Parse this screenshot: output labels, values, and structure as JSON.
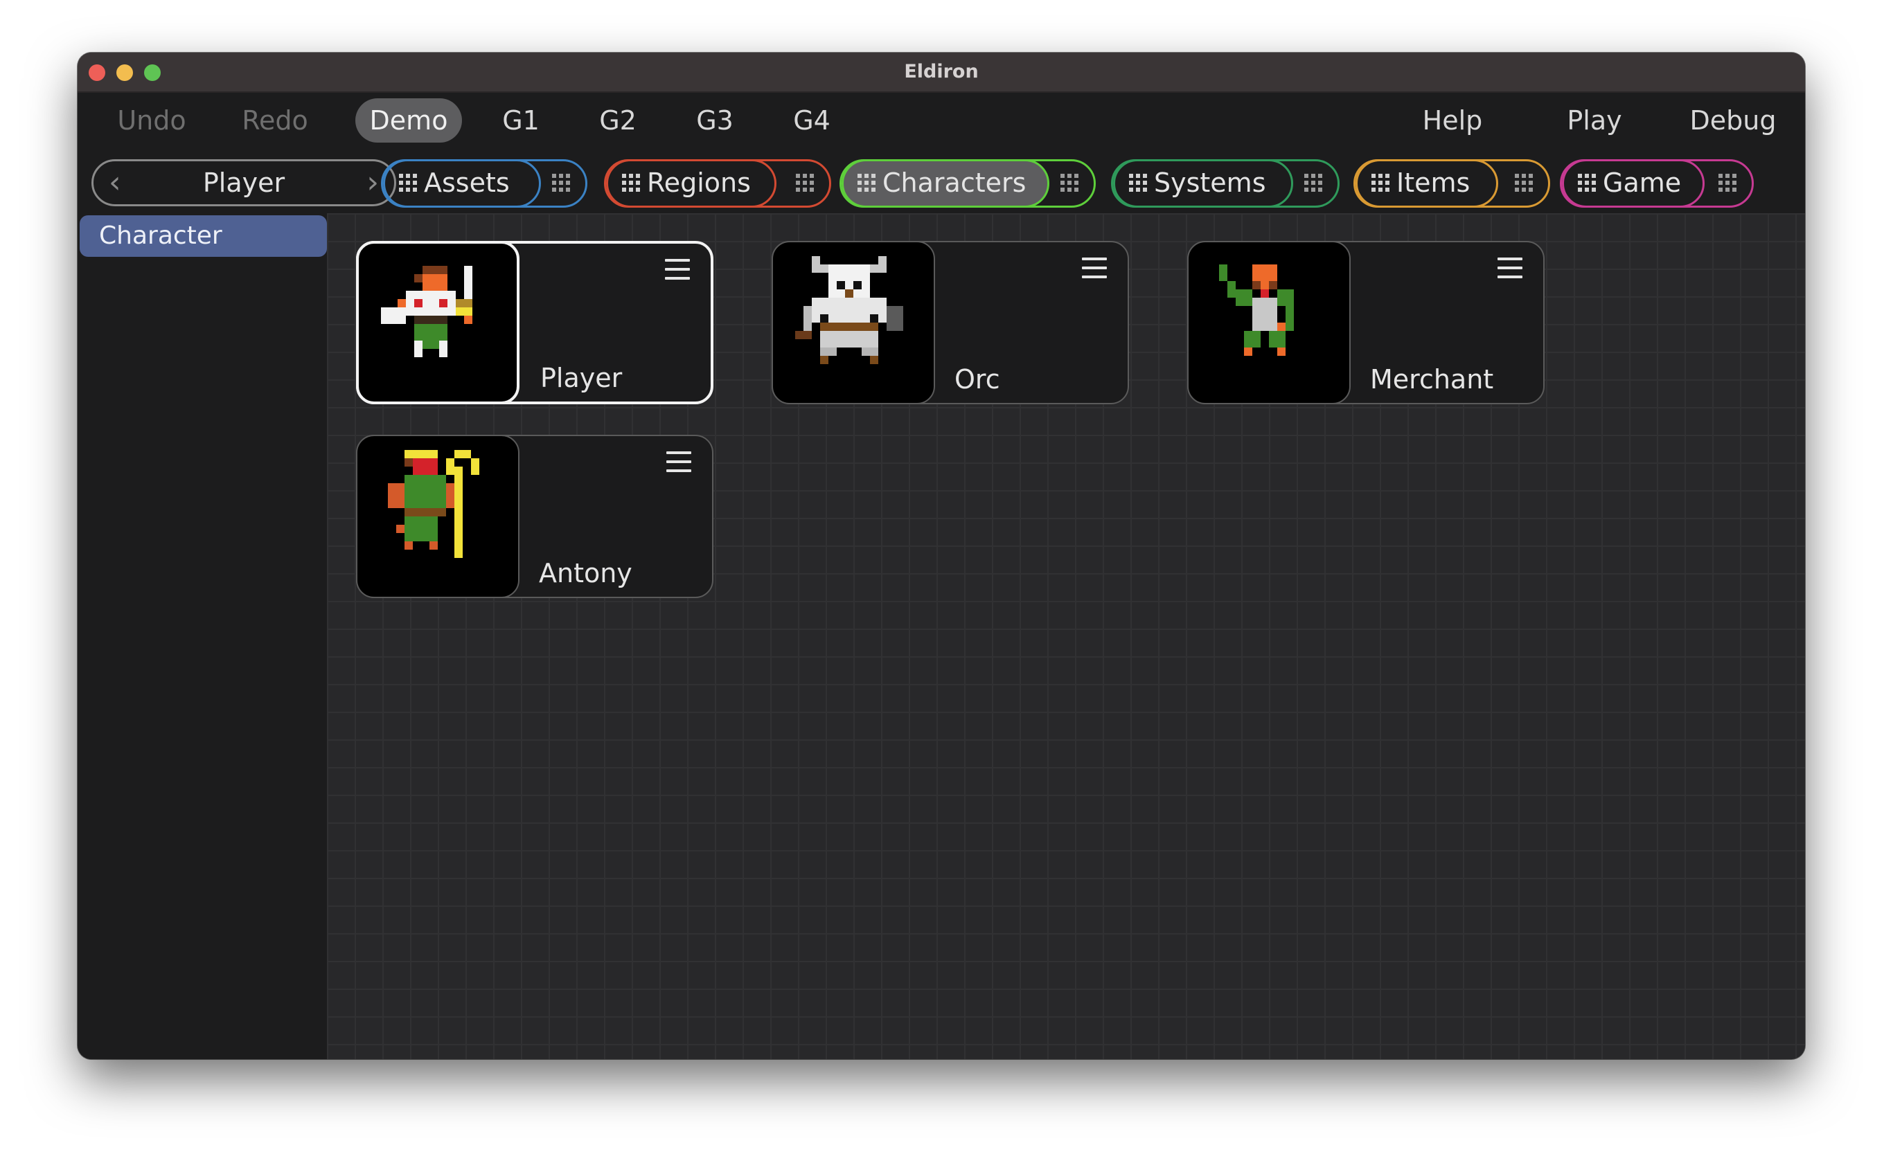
{
  "window": {
    "title": "Eldiron"
  },
  "menubar": {
    "undo": "Undo",
    "redo": "Redo",
    "demo": "Demo",
    "g1": "G1",
    "g2": "G2",
    "g3": "G3",
    "g4": "G4",
    "help": "Help",
    "play": "Play",
    "debug": "Debug"
  },
  "toolbar": {
    "nav_label": "Player",
    "groups": [
      {
        "label": "Assets",
        "color": "#3b82c4"
      },
      {
        "label": "Regions",
        "color": "#d34a32"
      },
      {
        "label": "Characters",
        "color": "#5ecf3b",
        "active": true
      },
      {
        "label": "Systems",
        "color": "#2f9a5b"
      },
      {
        "label": "Items",
        "color": "#d99a33"
      },
      {
        "label": "Game",
        "color": "#c63a92"
      }
    ]
  },
  "sidebar": {
    "items": [
      "Character"
    ]
  },
  "cards": [
    {
      "name": "Player",
      "selected": true,
      "icon": "player-sprite-icon"
    },
    {
      "name": "Orc",
      "icon": "orc-sprite-icon"
    },
    {
      "name": "Merchant",
      "icon": "merchant-sprite-icon"
    },
    {
      "name": "Antony",
      "icon": "antony-sprite-icon"
    }
  ]
}
